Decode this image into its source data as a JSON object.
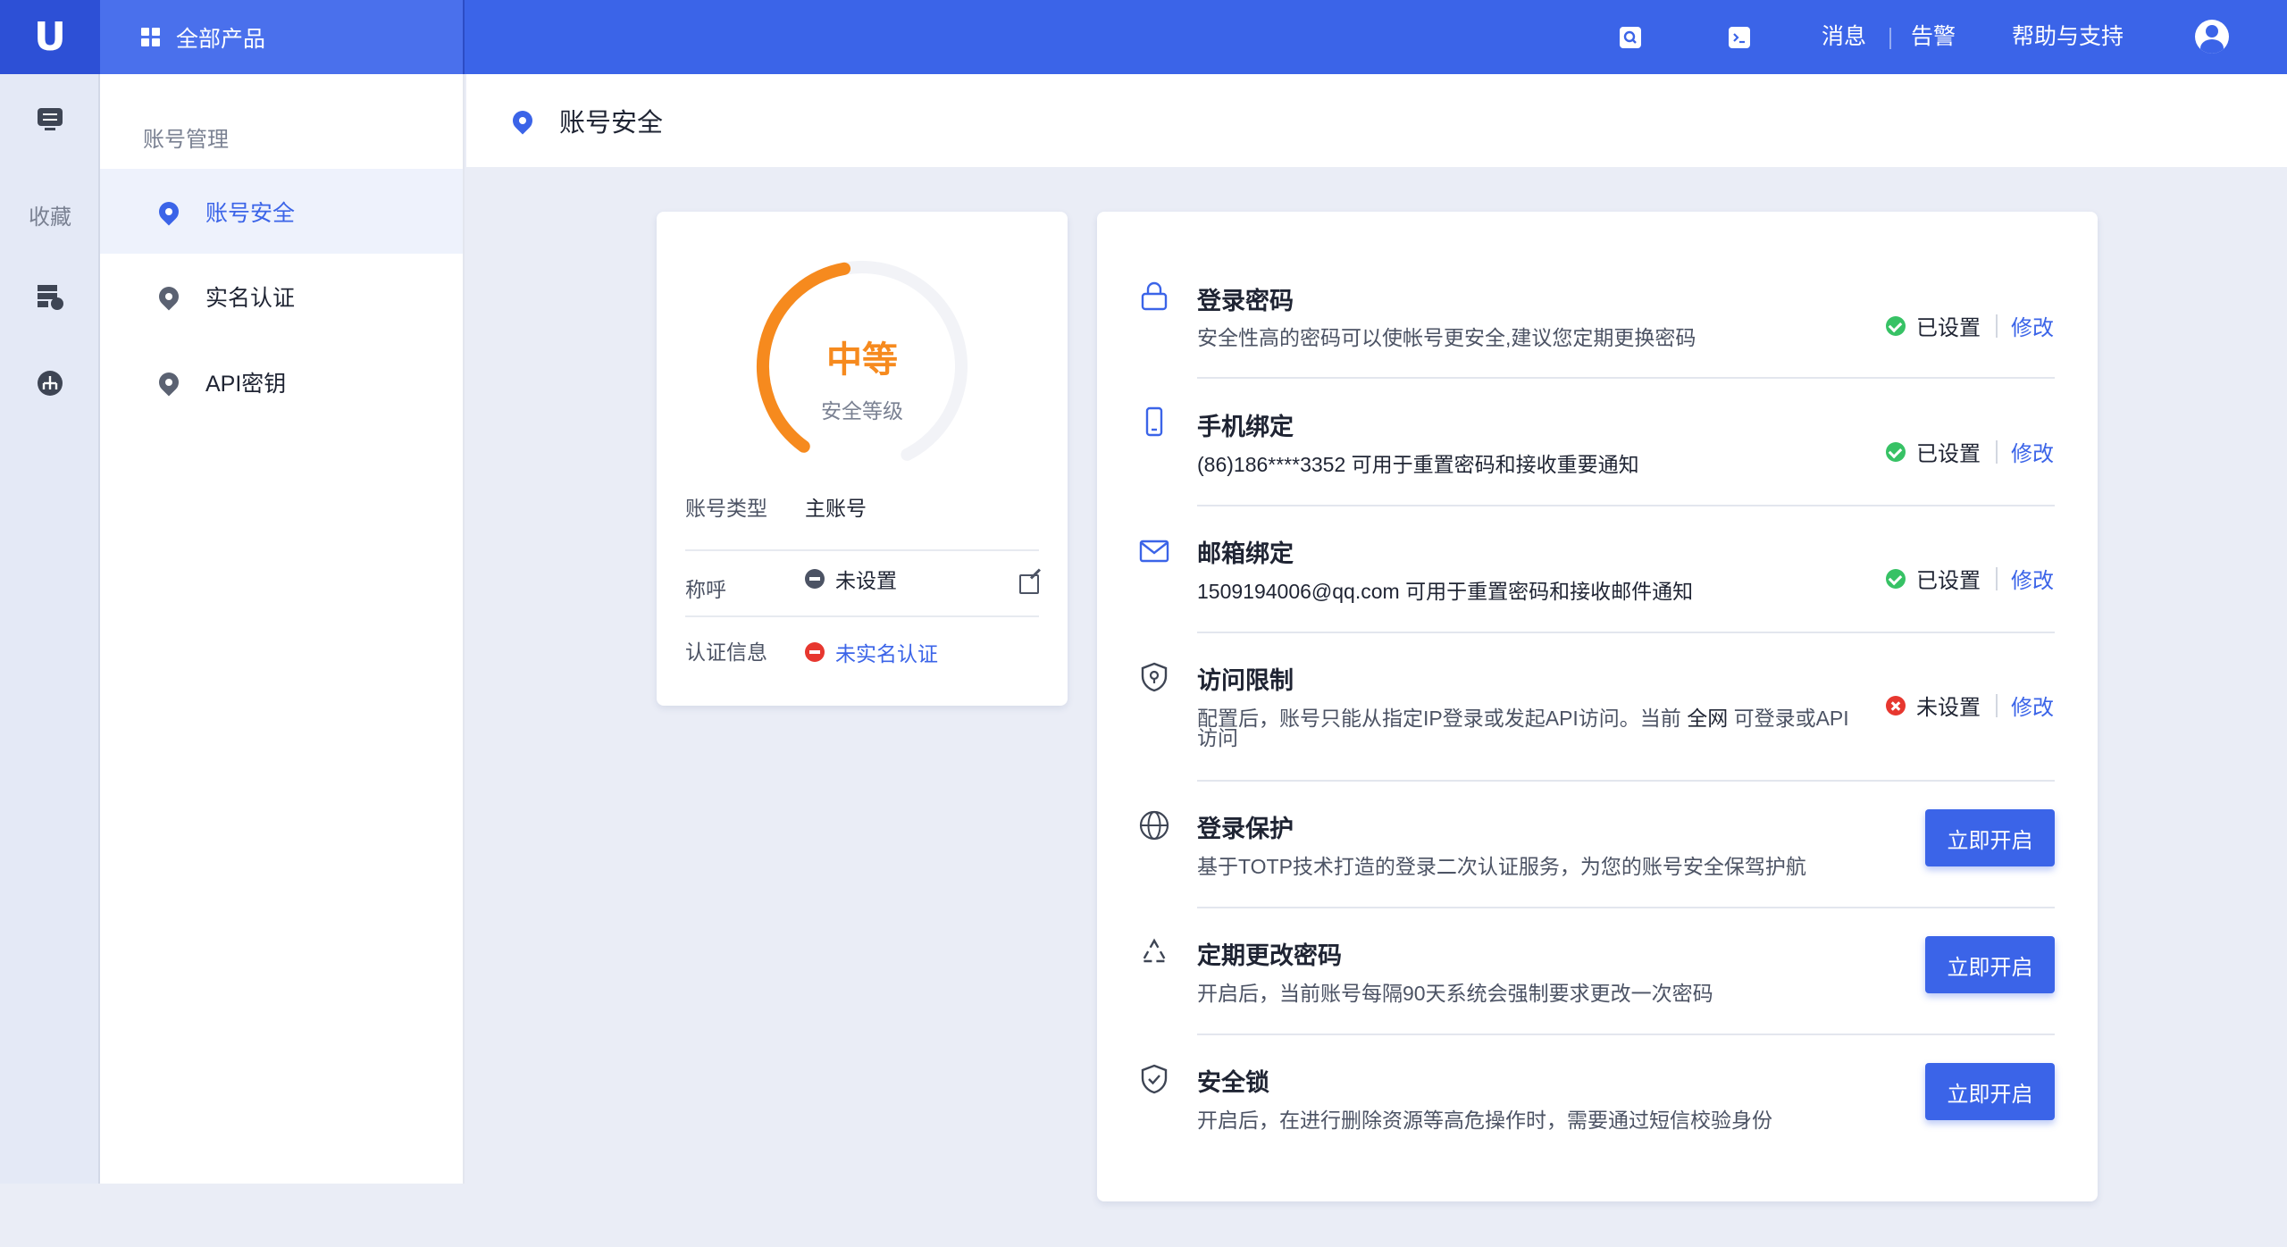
{
  "topbar": {
    "all_products": "全部产品",
    "messages": "消息",
    "alerts": "告警",
    "help": "帮助与支持"
  },
  "rail": {
    "favorites": "收藏"
  },
  "subside": {
    "title": "账号管理",
    "items": [
      {
        "label": "账号安全",
        "active": true
      },
      {
        "label": "实名认证",
        "active": false
      },
      {
        "label": "API密钥",
        "active": false
      }
    ]
  },
  "page": {
    "title": "账号安全"
  },
  "level": {
    "value": "中等",
    "label": "安全等级",
    "progress": 0.45,
    "color": "#f68a1e"
  },
  "account_info": {
    "type_label": "账号类型",
    "type_value": "主账号",
    "name_label": "称呼",
    "name_value": "未设置",
    "auth_label": "认证信息",
    "auth_value": "未实名认证"
  },
  "settings": {
    "status_set": "已设置",
    "status_unset": "未设置",
    "modify": "修改",
    "enable": "立即开启",
    "items": [
      {
        "title": "登录密码",
        "desc": "安全性高的密码可以使帐号更安全,建议您定期更换密码",
        "status": "已设置"
      },
      {
        "title": "手机绑定",
        "desc": "(86)186****3352  可用于重置密码和接收重要通知",
        "status": "已设置"
      },
      {
        "title": "邮箱绑定",
        "desc": "1509194006@qq.com  可用于重置密码和接收邮件通知",
        "status": "已设置"
      },
      {
        "title": "访问限制",
        "desc_a": "配置后，账号只能从指定IP登录或发起API访问。当前 ",
        "desc_hl": "全网",
        "desc_b": " 可登录或API",
        "desc_c": "访问",
        "status": "未设置"
      },
      {
        "title": "登录保护",
        "desc": "基于TOTP技术打造的登录二次认证服务，为您的账号安全保驾护航"
      },
      {
        "title": "定期更改密码",
        "desc": "开启后，当前账号每隔90天系统会强制要求更改一次密码"
      },
      {
        "title": "安全锁",
        "desc": "开启后，在进行删除资源等高危操作时，需要通过短信校验身份"
      }
    ]
  },
  "colors": {
    "brand": "#3b64e8",
    "warning": "#f68a1e",
    "success": "#37c265",
    "danger": "#e7372f"
  }
}
